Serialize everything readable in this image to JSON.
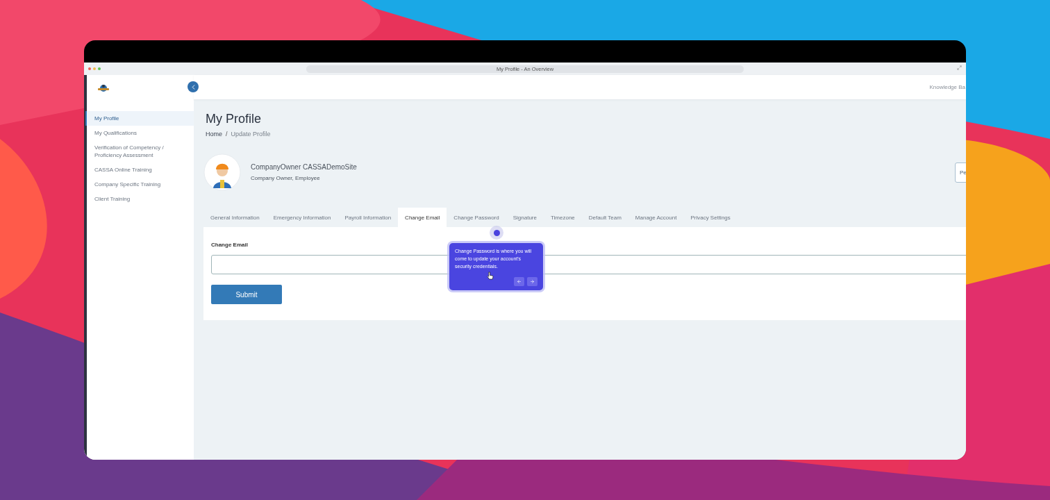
{
  "browser": {
    "title": "My Profile - An Overview"
  },
  "header": {
    "link": "Knowledge Ba"
  },
  "sidebar": {
    "items": [
      {
        "label": "My Profile",
        "selected": true
      },
      {
        "label": "My Qualifications",
        "selected": false
      },
      {
        "label": "Verification of Competency / Proficiency Assessment",
        "selected": false
      },
      {
        "label": "CASSA Online Training",
        "selected": false
      },
      {
        "label": "Company Specific Training",
        "selected": false
      },
      {
        "label": "Client Training",
        "selected": false
      }
    ]
  },
  "page": {
    "title": "My Profile",
    "breadcrumb": [
      "Home",
      "Update Profile"
    ],
    "separator": "/"
  },
  "profile": {
    "name": "CompanyOwner CASSADemoSite",
    "role": "Company Owner, Employee",
    "button": "Pe"
  },
  "tabs": [
    {
      "label": "General Information",
      "selected": false
    },
    {
      "label": "Emergency Information",
      "selected": false
    },
    {
      "label": "Payroll Information",
      "selected": false
    },
    {
      "label": "Change Email",
      "selected": true
    },
    {
      "label": "Change Password",
      "selected": false
    },
    {
      "label": "Signature",
      "selected": false
    },
    {
      "label": "Timezone",
      "selected": false
    },
    {
      "label": "Default Team",
      "selected": false
    },
    {
      "label": "Manage Account",
      "selected": false
    },
    {
      "label": "Privacy Settings",
      "selected": false
    }
  ],
  "form": {
    "label": "Change Email",
    "submit": "Submit"
  },
  "tour": {
    "text": "Change Password is where you will come to update your account's security credentials."
  }
}
